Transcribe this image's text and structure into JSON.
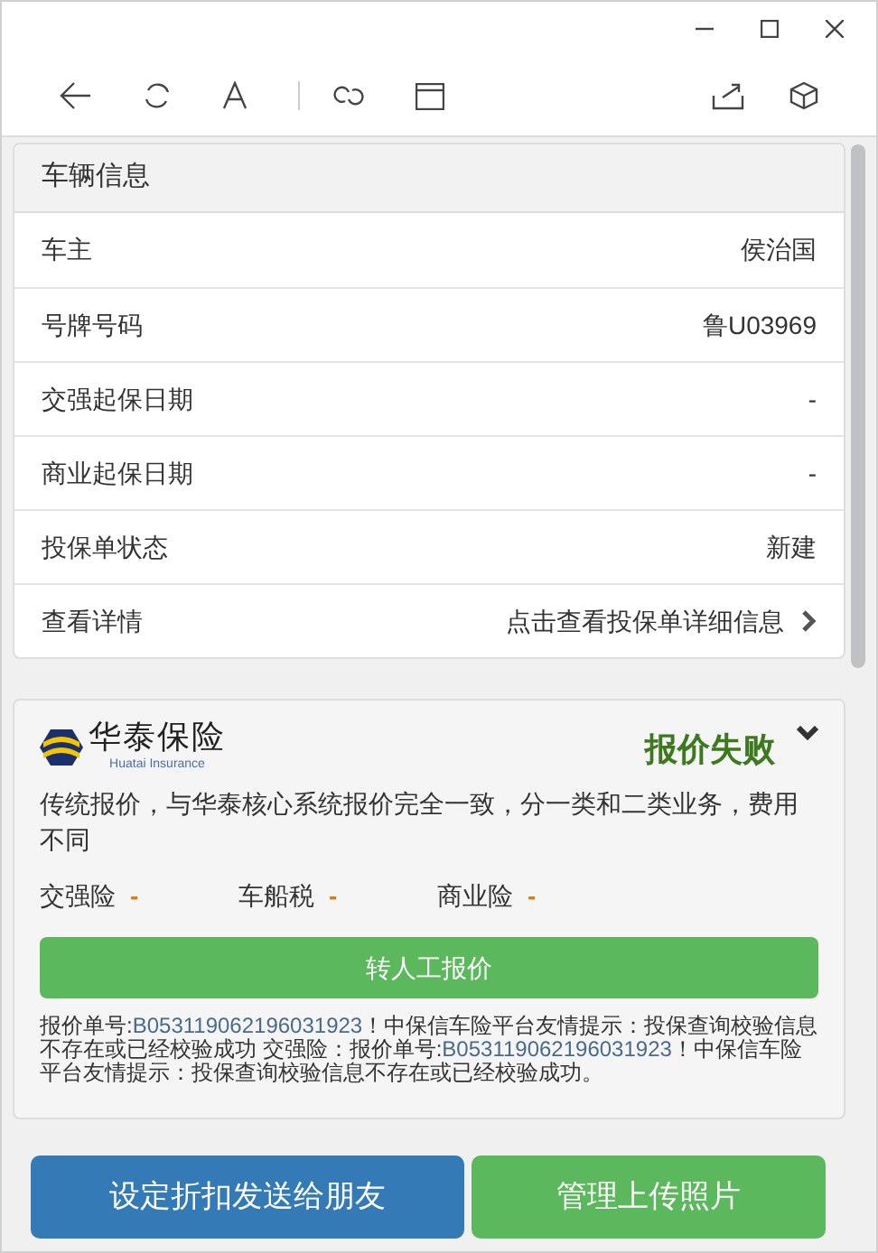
{
  "vehicle_info": {
    "title": "车辆信息",
    "rows": [
      {
        "kind": "field",
        "label": "车主",
        "value": "侯治国"
      },
      {
        "kind": "field",
        "label": "号牌号码",
        "value": "鲁U03969"
      },
      {
        "kind": "field",
        "label": "交强起保日期",
        "value": "-"
      },
      {
        "kind": "field",
        "label": "商业起保日期",
        "value": "-"
      },
      {
        "kind": "field",
        "label": "投保单状态",
        "value": "新建"
      },
      {
        "kind": "link",
        "label": "查看详情",
        "value": "点击查看投保单详细信息"
      }
    ]
  },
  "quote": {
    "logo_text": "华泰保险",
    "logo_subtext": "Huatai Insurance",
    "status": "报价失败",
    "expanded": true,
    "description": "传统报价，与华泰核心系统报价完全一致，分一类和二类业务，费用不同",
    "premiums": [
      {
        "label": "交强险",
        "value": "-"
      },
      {
        "label": "车船税",
        "value": "-"
      },
      {
        "label": "商业险",
        "value": "-"
      }
    ],
    "manual_button": "转人工报价",
    "message_parts": [
      {
        "kind": "text",
        "text": "报价单号:"
      },
      {
        "kind": "code",
        "text": "B053119062196031923"
      },
      {
        "kind": "text",
        "text": "！中保信车险平台友情提示：投保查询校验信息不存在或已经校验成功 交强险：报价单号:"
      },
      {
        "kind": "code",
        "text": "B053119062196031923"
      },
      {
        "kind": "text",
        "text": "！中保信车险平台友情提示：投保查询校验信息不存在或已经校验成功。"
      }
    ]
  },
  "buttons": [
    {
      "kind": "primary",
      "label": "设定折扣发送给朋友"
    },
    {
      "kind": "success",
      "label": "管理上传照片"
    }
  ]
}
